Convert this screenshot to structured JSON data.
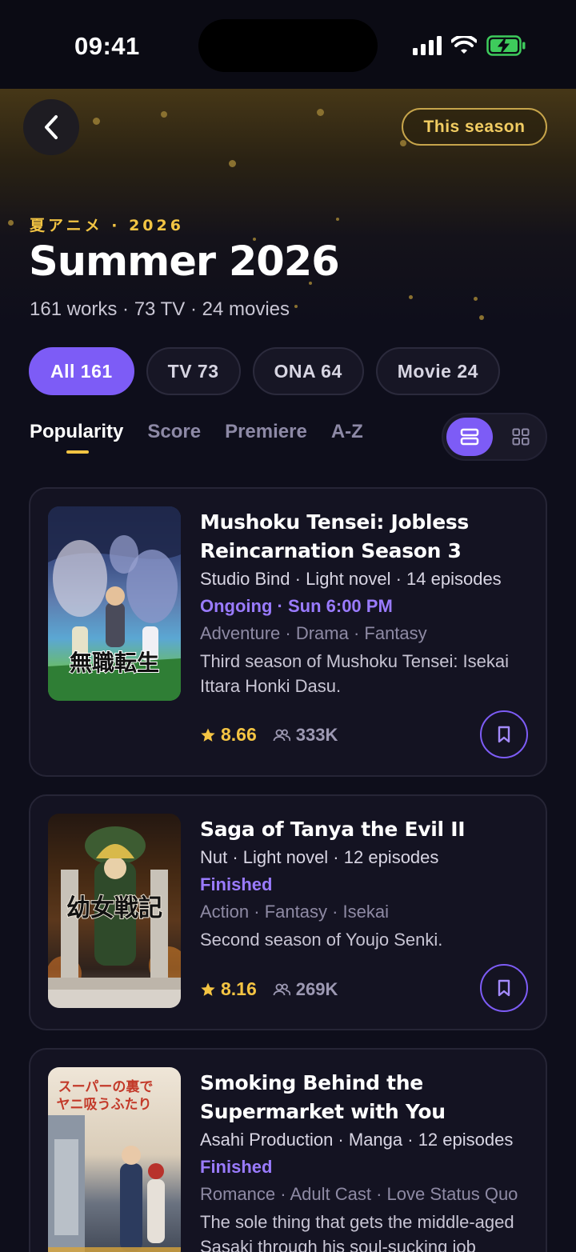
{
  "status_bar": {
    "time": "09:41"
  },
  "header": {
    "season_button": "This season",
    "eyebrow": "夏アニメ · 2026",
    "title": "Summer 2026",
    "subtitle": "161 works · 73 TV · 24 movies"
  },
  "filters": [
    {
      "label": "All 161",
      "active": true
    },
    {
      "label": "TV 73",
      "active": false
    },
    {
      "label": "ONA 64",
      "active": false
    },
    {
      "label": "Movie 24",
      "active": false
    }
  ],
  "sort_tabs": [
    {
      "label": "Popularity",
      "active": true
    },
    {
      "label": "Score",
      "active": false
    },
    {
      "label": "Premiere",
      "active": false
    },
    {
      "label": "A-Z",
      "active": false
    }
  ],
  "view_mode": "list",
  "colors": {
    "accent": "#7d5cf6",
    "gold": "#f2c443",
    "background": "#0e0e1b"
  },
  "cards": [
    {
      "title": "Mushoku Tensei: Jobless Reincarnation Season 3",
      "meta": "Studio Bind · Light novel · 14 episodes",
      "status": "Ongoing · Sun 6:00 PM",
      "genres": "Adventure · Drama · Fantasy",
      "description": "Third season of Mushoku Tensei: Isekai Ittara Honki Dasu.",
      "rating": "8.66",
      "watchers": "333K",
      "poster_text": "無職転生"
    },
    {
      "title": "Saga of Tanya the Evil II",
      "meta": "Nut · Light novel · 12 episodes",
      "status": "Finished",
      "genres": "Action · Fantasy · Isekai",
      "description": "Second season of Youjo Senki.",
      "rating": "8.16",
      "watchers": "269K",
      "poster_text": "幼女戦記"
    },
    {
      "title": "Smoking Behind the Supermarket with You",
      "meta": "Asahi Production · Manga · 12 episodes",
      "status": "Finished",
      "genres": "Romance · Adult Cast · Love Status Quo",
      "description": "The sole thing that gets the middle-aged Sasaki through his soul-sucking job",
      "poster_text": "スーパーの裏でヤニ吸うふたり"
    }
  ]
}
